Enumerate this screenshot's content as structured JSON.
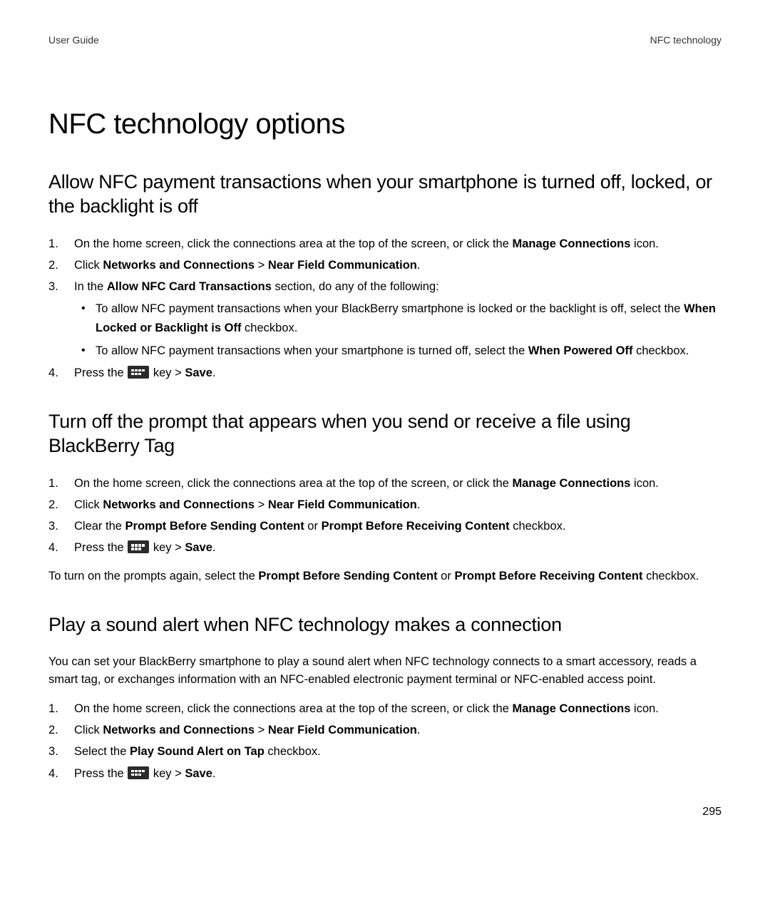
{
  "header": {
    "left": "User Guide",
    "right": "NFC technology"
  },
  "title": "NFC technology options",
  "sections": [
    {
      "heading": "Allow NFC payment transactions when your smartphone is turned off, locked, or the backlight is off",
      "steps": [
        {
          "pre": "On the home screen, click the connections area at the top of the screen, or click the ",
          "b1": "Manage Connections",
          "post": " icon."
        },
        {
          "pre": "Click ",
          "b1": "Networks and Connections",
          "mid1": " > ",
          "b2": "Near Field Communication",
          "post": "."
        },
        {
          "pre": "In the ",
          "b1": "Allow NFC Card Transactions",
          "post": " section, do any of the following:",
          "bullets": [
            {
              "pre": "To allow NFC payment transactions when your BlackBerry smartphone is locked or the backlight is off, select the ",
              "b1": "When Locked or Backlight is Off",
              "post": " checkbox."
            },
            {
              "pre": "To allow NFC payment transactions when your smartphone is turned off, select the ",
              "b1": "When Powered Off",
              "post": " checkbox."
            }
          ]
        },
        {
          "press": true,
          "save": "Save"
        }
      ]
    },
    {
      "heading": "Turn off the prompt that appears when you send or receive a file using BlackBerry Tag",
      "steps": [
        {
          "pre": "On the home screen, click the connections area at the top of the screen, or click the ",
          "b1": "Manage Connections",
          "post": " icon."
        },
        {
          "pre": "Click ",
          "b1": "Networks and Connections",
          "mid1": " > ",
          "b2": "Near Field Communication",
          "post": "."
        },
        {
          "pre": "Clear the ",
          "b1": "Prompt Before Sending Content",
          "mid1": " or ",
          "b2": "Prompt Before Receiving Content",
          "post": " checkbox."
        },
        {
          "press": true,
          "save": "Save"
        }
      ],
      "after": {
        "pre": "To turn on the prompts again, select the ",
        "b1": "Prompt Before Sending Content",
        "mid1": " or ",
        "b2": "Prompt Before Receiving Content",
        "post": " checkbox."
      }
    },
    {
      "heading": "Play a sound alert when NFC technology makes a connection",
      "intro": "You can set your BlackBerry smartphone to play a sound alert when NFC technology connects to a smart accessory, reads a smart tag, or exchanges information with an NFC-enabled electronic payment terminal or NFC-enabled access point.",
      "steps": [
        {
          "pre": "On the home screen, click the connections area at the top of the screen, or click the ",
          "b1": "Manage Connections",
          "post": " icon."
        },
        {
          "pre": "Click ",
          "b1": "Networks and Connections",
          "mid1": " > ",
          "b2": "Near Field Communication",
          "post": "."
        },
        {
          "pre": "Select the ",
          "b1": "Play Sound Alert on Tap",
          "post": " checkbox."
        },
        {
          "press": true,
          "save": "Save"
        }
      ]
    }
  ],
  "press_label": "Press the ",
  "key_label": " key > ",
  "page_number": "295"
}
